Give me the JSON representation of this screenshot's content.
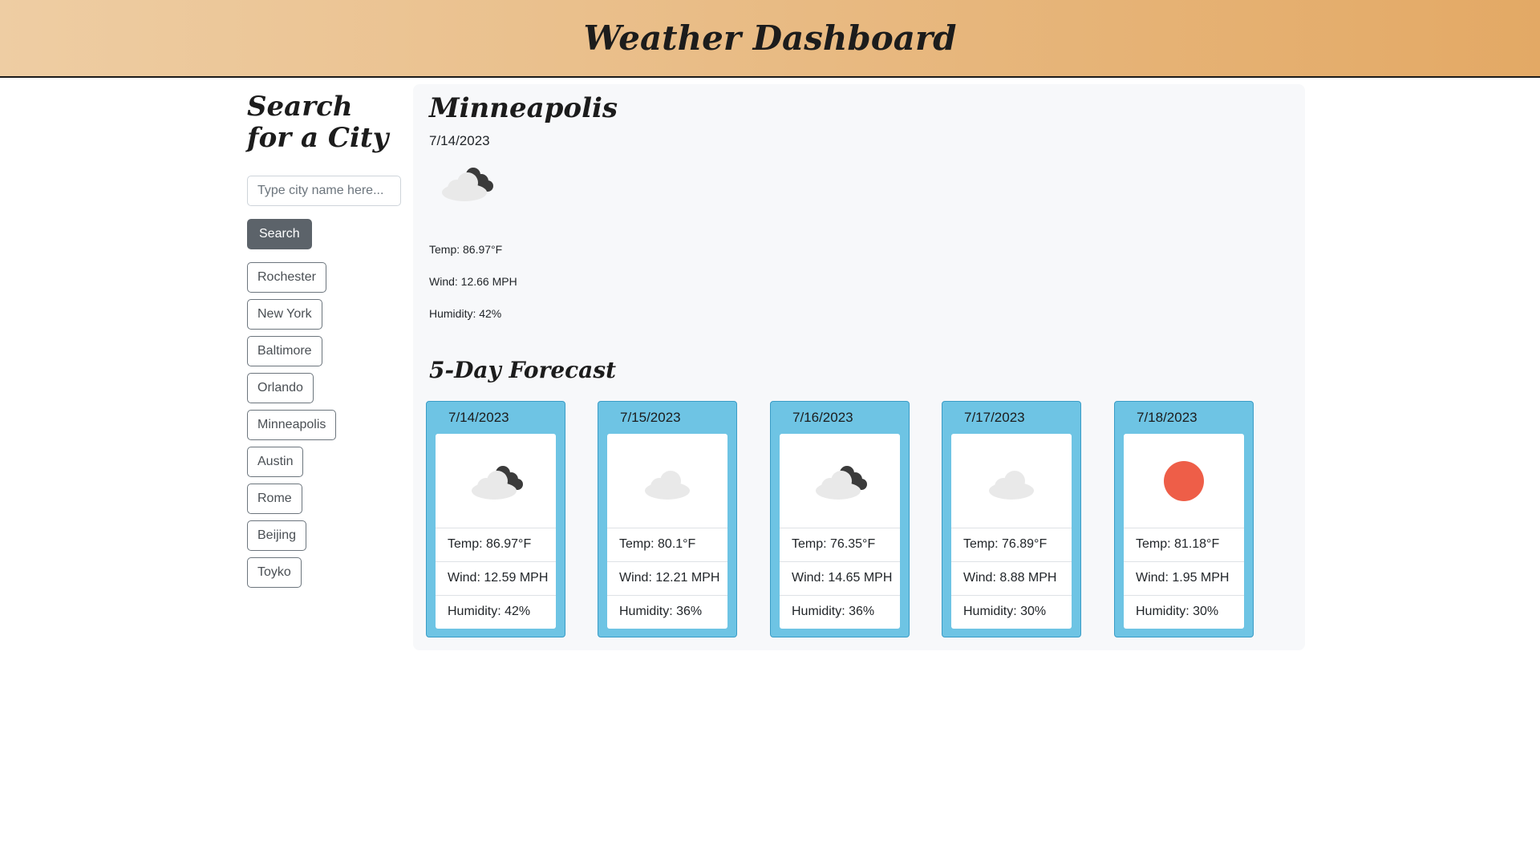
{
  "header": {
    "title": "Weather Dashboard"
  },
  "search": {
    "heading": "Search for a City",
    "placeholder": "Type city name here...",
    "button_label": "Search",
    "history": [
      "Rochester",
      "New York",
      "Baltimore",
      "Orlando",
      "Minneapolis",
      "Austin",
      "Rome",
      "Beijing",
      "Toyko"
    ]
  },
  "current": {
    "city": "Minneapolis",
    "date": "7/14/2023",
    "icon": "partly-cloudy-icon",
    "temp": "Temp: 86.97°F",
    "wind": "Wind: 12.66 MPH",
    "humidity": "Humidity: 42%"
  },
  "forecast": {
    "heading": "5-Day Forecast",
    "days": [
      {
        "date": "7/14/2023",
        "icon": "partly-cloudy-icon",
        "temp": "Temp: 86.97°F",
        "wind": "Wind: 12.59 MPH",
        "humidity": "Humidity: 42%"
      },
      {
        "date": "7/15/2023",
        "icon": "cloud-icon",
        "temp": "Temp: 80.1°F",
        "wind": "Wind: 12.21 MPH",
        "humidity": "Humidity: 36%"
      },
      {
        "date": "7/16/2023",
        "icon": "partly-cloudy-icon",
        "temp": "Temp: 76.35°F",
        "wind": "Wind: 14.65 MPH",
        "humidity": "Humidity: 36%"
      },
      {
        "date": "7/17/2023",
        "icon": "cloud-icon",
        "temp": "Temp: 76.89°F",
        "wind": "Wind: 8.88 MPH",
        "humidity": "Humidity: 30%"
      },
      {
        "date": "7/18/2023",
        "icon": "sun-icon",
        "temp": "Temp: 81.18°F",
        "wind": "Wind: 1.95 MPH",
        "humidity": "Humidity: 30%"
      }
    ]
  },
  "colors": {
    "header_gradient_start": "#eecda3",
    "header_gradient_end": "#e3a965",
    "card_background": "#6ec4e4",
    "search_button": "#5c636a",
    "sun": "#ee5e48"
  }
}
